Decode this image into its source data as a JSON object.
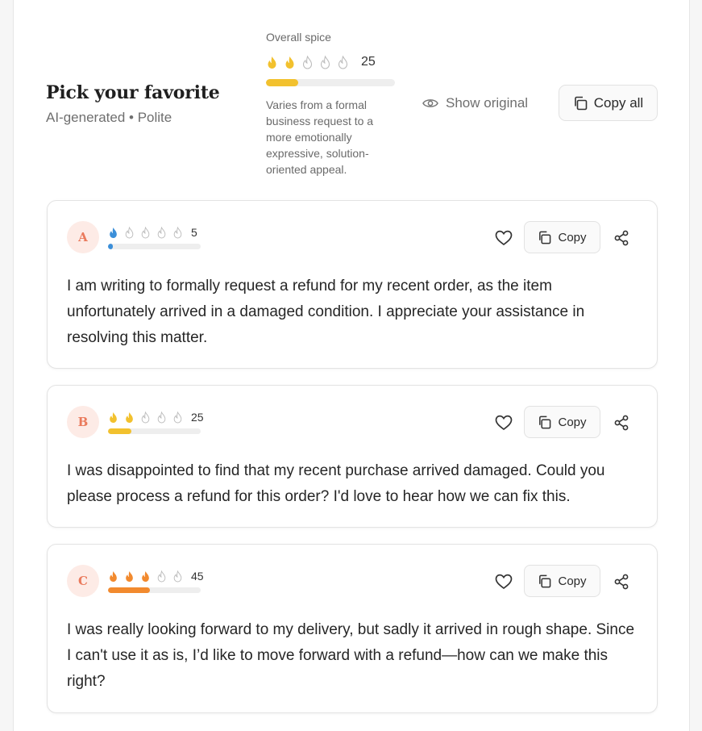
{
  "header": {
    "title": "Pick your favorite",
    "subtitle": "AI-generated • Polite",
    "overall_spice_label": "Overall spice",
    "overall_spice_value": "25",
    "overall_spice_level": 2,
    "overall_spice_fraction": 0.25,
    "spice_description": "Varies from a formal business request to a more emotionally expressive, solution-oriented appeal.",
    "show_original_label": "Show original",
    "show_original_icon": "eye-icon",
    "copy_all_label": "Copy all",
    "copy_all_icon": "copy-icon"
  },
  "colors": {
    "spice_yellow": "#f2c12e",
    "spice_blue": "#3b8fd9",
    "spice_orange": "#f28a2e",
    "avatar_text": "#ea7a5c",
    "avatar_bg": "#fdebe6"
  },
  "options": [
    {
      "letter": "A",
      "spice_value": "5",
      "flames": 1,
      "color": "#3b8fd9",
      "fraction": 0.05,
      "copy_label": "Copy",
      "text": "I am writing to formally request a refund for my recent order, as the item unfortunately arrived in a damaged condition. I appreciate your assistance in resolving this matter."
    },
    {
      "letter": "B",
      "spice_value": "25",
      "flames": 2,
      "color": "#f2c12e",
      "fraction": 0.25,
      "copy_label": "Copy",
      "text": "I was disappointed to find that my recent purchase arrived damaged. Could you please process a refund for this order? I'd love to hear how we can fix this."
    },
    {
      "letter": "C",
      "spice_value": "45",
      "flames": 3,
      "color": "#f28a2e",
      "fraction": 0.45,
      "copy_label": "Copy",
      "text": "I was really looking forward to my delivery, but sadly it arrived in rough shape. Since I can't use it as is, I’d like to move forward with a refund—how can we make this right?"
    }
  ]
}
